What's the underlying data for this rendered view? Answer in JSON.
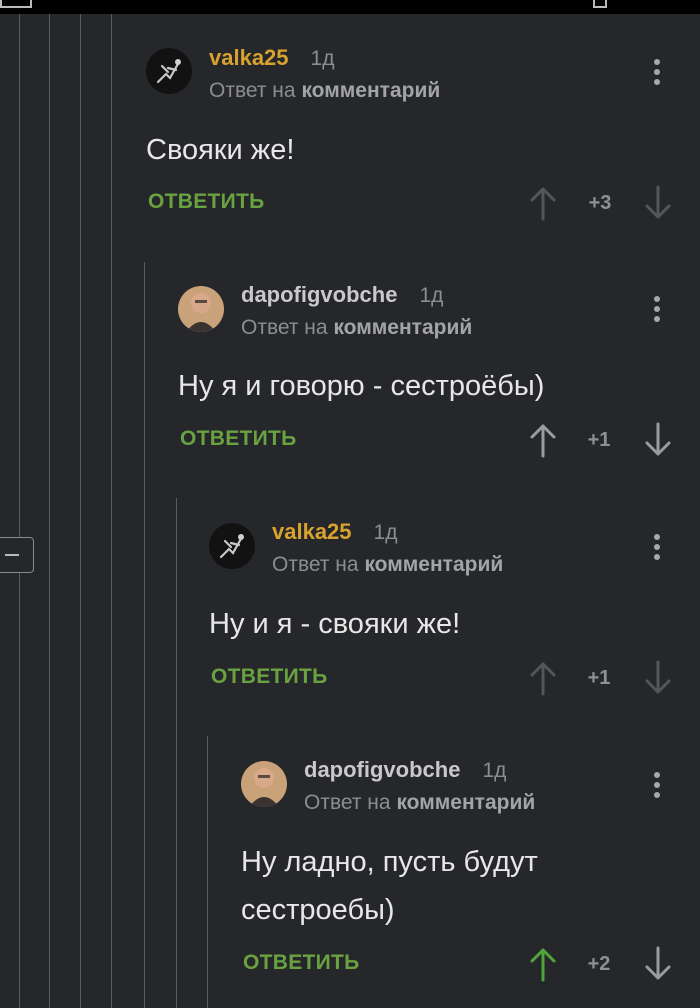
{
  "comments": [
    {
      "author": "valka25",
      "time": "1д",
      "reply_prefix": "Ответ на",
      "reply_target": "комментарий",
      "text": [
        "Свояки же!"
      ],
      "reply_label": "ОТВЕТИТЬ",
      "score": "+3",
      "upvoted": false
    },
    {
      "author": "dapofigvobche",
      "time": "1д",
      "reply_prefix": "Ответ на",
      "reply_target": "комментарий",
      "text": [
        "Ну я и говорю - сестроёбы)"
      ],
      "reply_label": "ОТВЕТИТЬ",
      "score": "+1",
      "upvoted": false
    },
    {
      "author": "valka25",
      "time": "1д",
      "reply_prefix": "Ответ на",
      "reply_target": "комментарий",
      "text": [
        "Ну и я - свояки же!"
      ],
      "reply_label": "ОТВЕТИТЬ",
      "score": "+1",
      "upvoted": false
    },
    {
      "author": "dapofigvobche",
      "time": "1д",
      "reply_prefix": "Ответ на",
      "reply_target": "комментарий",
      "text": [
        "Ну ладно, пусть будут",
        "сестроебы)"
      ],
      "reply_label": "ОТВЕТИТЬ",
      "score": "+2",
      "upvoted": true
    }
  ],
  "colors": {
    "background": "#26272a",
    "author_gold": "#d8a22e",
    "reply_green": "#69a240",
    "upvote_active": "#4fa63a",
    "muted": "#8c8d90"
  }
}
